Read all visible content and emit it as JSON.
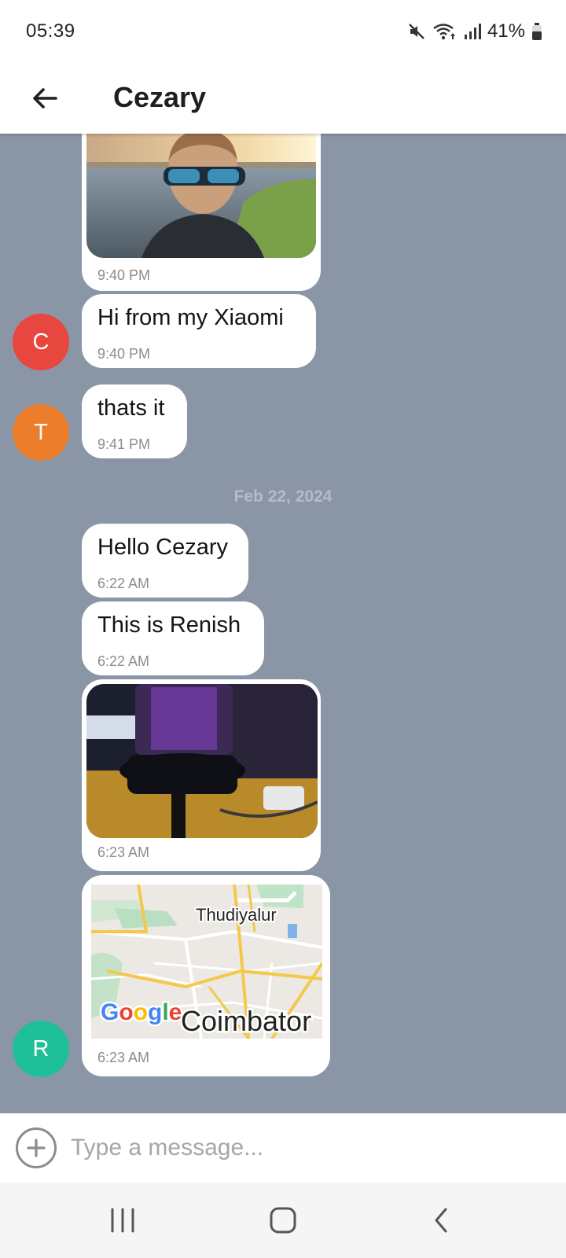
{
  "status_bar": {
    "time": "05:39",
    "battery": "41%",
    "icons": [
      "mute-icon",
      "wifi-icon",
      "signal-icon",
      "battery-icon"
    ]
  },
  "header": {
    "title": "Cezary",
    "back_icon": "arrow-left-icon"
  },
  "messages": [
    {
      "type": "image",
      "image": "selfie-photo",
      "time": "9:40 PM"
    },
    {
      "type": "text",
      "text": "Hi from my Xiaomi",
      "time": "9:40 PM",
      "avatar": "C"
    },
    {
      "type": "text",
      "text": "thats it",
      "time": "9:41 PM",
      "avatar": "T"
    },
    {
      "type": "text",
      "text": "Hello Cezary",
      "time": "6:22 AM"
    },
    {
      "type": "text",
      "text": "This is Renish",
      "time": "6:22 AM"
    },
    {
      "type": "image",
      "image": "microphone-photo",
      "time": "6:23 AM"
    },
    {
      "type": "map",
      "map_labels": [
        "Thudiyalur",
        "Coimbator"
      ],
      "map_brand": "Google",
      "time": "6:23 AM",
      "avatar": "R"
    }
  ],
  "date_separator": "Feb 22, 2024",
  "avatar_colors": {
    "C": "#e8473f",
    "T": "#ec7d2b",
    "R": "#1fbf97"
  },
  "input": {
    "placeholder": "Type a message...",
    "value": "",
    "attach_icon": "plus-circle-icon"
  },
  "nav": {
    "icons": [
      "recent-apps-icon",
      "home-icon",
      "back-icon"
    ]
  }
}
